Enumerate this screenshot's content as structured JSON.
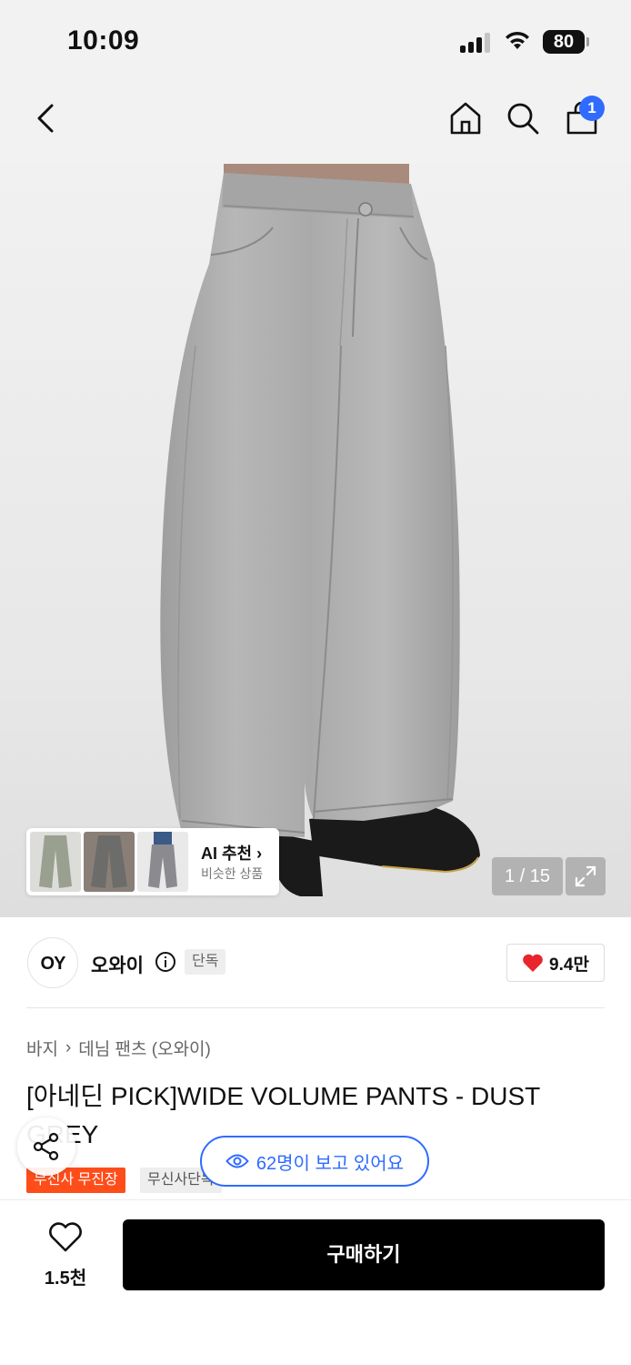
{
  "status_bar": {
    "time": "10:09",
    "battery": "80"
  },
  "nav": {
    "cart_count": "1",
    "icons": [
      "back-icon",
      "home-icon",
      "search-icon",
      "cart-icon"
    ]
  },
  "gallery": {
    "counter": "1 / 15",
    "ai_reco": {
      "title": "AI 추천",
      "subtitle": "비슷한 상품"
    }
  },
  "brand": {
    "logo_text": "OY",
    "name": "오와이",
    "tag": "단독",
    "likes": "9.4만"
  },
  "breadcrumb": {
    "level1": "바지",
    "level2": "데님 팬츠 (오와이)"
  },
  "product": {
    "title": "[아네딘 PICK]WIDE VOLUME PANTS - DUST GREY",
    "chip_free_shipping": "무신사 무진장",
    "chip_exclusive": "무신사단독"
  },
  "viewers": {
    "text": "62명이 보고 있어요"
  },
  "bottom": {
    "wish_count": "1.5천",
    "buy_label": "구매하기"
  },
  "colors": {
    "accent_blue": "#2f6bff",
    "tag_red": "#ff4d1a",
    "heart_red": "#e8242c",
    "buy_black": "#000000"
  }
}
